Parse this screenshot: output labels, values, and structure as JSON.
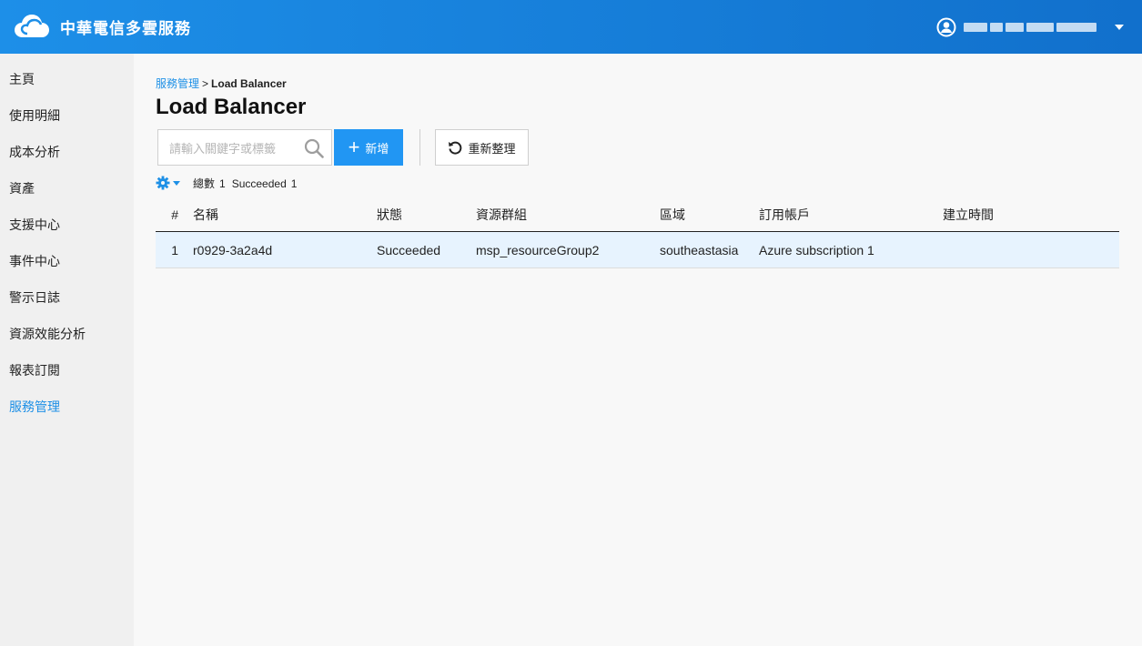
{
  "app": {
    "title": "中華電信多雲服務",
    "user_name": "████ ███ ████ ████"
  },
  "sidebar": {
    "items": [
      {
        "label": "主頁"
      },
      {
        "label": "使用明細"
      },
      {
        "label": "成本分析"
      },
      {
        "label": "資產"
      },
      {
        "label": "支援中心"
      },
      {
        "label": "事件中心"
      },
      {
        "label": "警示日誌"
      },
      {
        "label": "資源效能分析"
      },
      {
        "label": "報表訂閱"
      },
      {
        "label": "服務管理",
        "active": true
      }
    ]
  },
  "breadcrumb": {
    "parent": "服務管理",
    "separator": ">",
    "current": "Load Balancer"
  },
  "page": {
    "title": "Load Balancer"
  },
  "toolbar": {
    "search_placeholder": "請輸入關鍵字或標籤",
    "search_value": "",
    "add_label": "新增",
    "refresh_label": "重新整理"
  },
  "summary": {
    "total_label": "總數",
    "total_count": "1",
    "status_label": "Succeeded",
    "status_count": "1"
  },
  "table": {
    "headers": [
      "#",
      "名稱",
      "狀態",
      "資源群組",
      "區域",
      "訂用帳戶",
      "建立時間"
    ],
    "rows": [
      [
        "1",
        "r0929-3a2a4d",
        "Succeeded",
        "msp_resourceGroup2",
        "southeastasia",
        "Azure subscription 1",
        ""
      ]
    ]
  },
  "colors": {
    "topbar_start": "#1d8fe8",
    "topbar_end": "#1170cc",
    "accent": "#1e90e6",
    "add_button": "#2196f3",
    "row_highlight": "#e7f3fe"
  },
  "icons": {
    "logo": "cloud-logo-icon",
    "user": "user-circle-icon",
    "search": "search-icon",
    "add": "plus-icon",
    "refresh": "refresh-icon",
    "settings": "gear-icon"
  }
}
